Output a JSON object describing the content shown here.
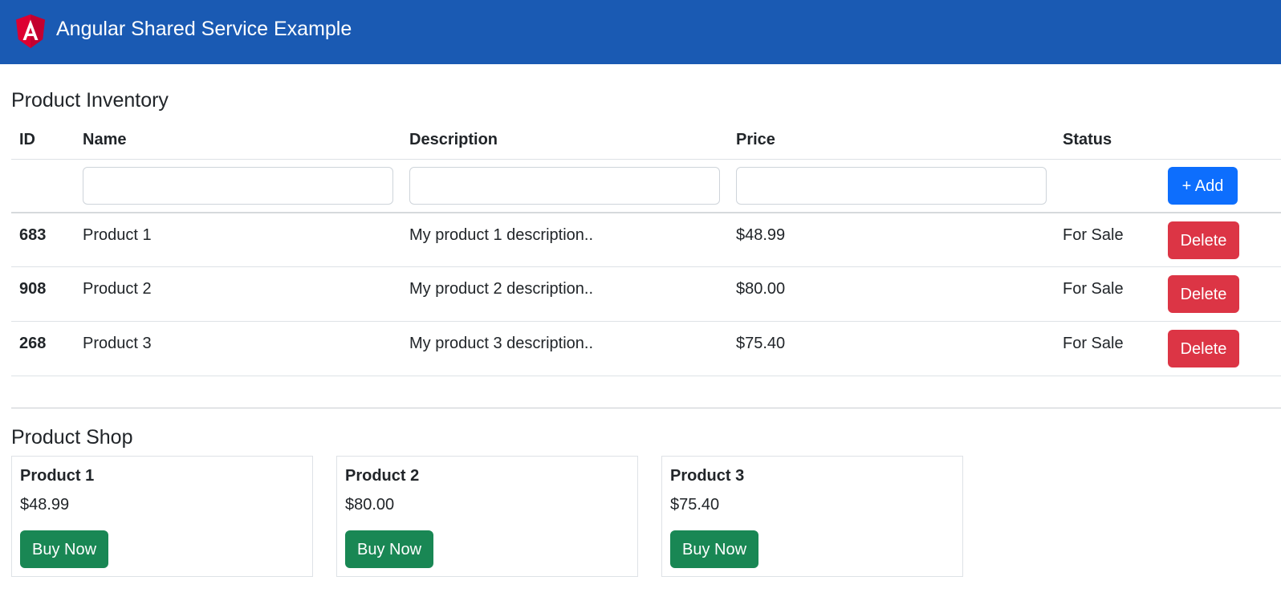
{
  "header": {
    "title": "Angular Shared Service Example",
    "logo_icon": "angular-logo-icon",
    "logo_letter": "A",
    "background": "#1a5ab3"
  },
  "inventory": {
    "title": "Product Inventory",
    "columns": [
      "ID",
      "Name",
      "Description",
      "Price",
      "Status"
    ],
    "new_row": {
      "name_value": "",
      "description_value": "",
      "price_value": "",
      "add_label": "+ Add"
    },
    "rows": [
      {
        "id": "683",
        "name": "Product 1",
        "description": "My product 1 description..",
        "price": "$48.99",
        "status": "For Sale",
        "action": "Delete"
      },
      {
        "id": "908",
        "name": "Product 2",
        "description": "My product 2 description..",
        "price": "$80.00",
        "status": "For Sale",
        "action": "Delete"
      },
      {
        "id": "268",
        "name": "Product 3",
        "description": "My product 3 description..",
        "price": "$75.40",
        "status": "For Sale",
        "action": "Delete"
      }
    ]
  },
  "shop": {
    "title": "Product Shop",
    "cards": [
      {
        "name": "Product 1",
        "price": "$48.99",
        "button": "Buy Now"
      },
      {
        "name": "Product 2",
        "price": "$80.00",
        "button": "Buy Now"
      },
      {
        "name": "Product 3",
        "price": "$75.40",
        "button": "Buy Now"
      }
    ]
  },
  "colors": {
    "primary": "#0d6efd",
    "danger": "#dc3545",
    "success": "#198754",
    "angular_red": "#dd0031"
  }
}
